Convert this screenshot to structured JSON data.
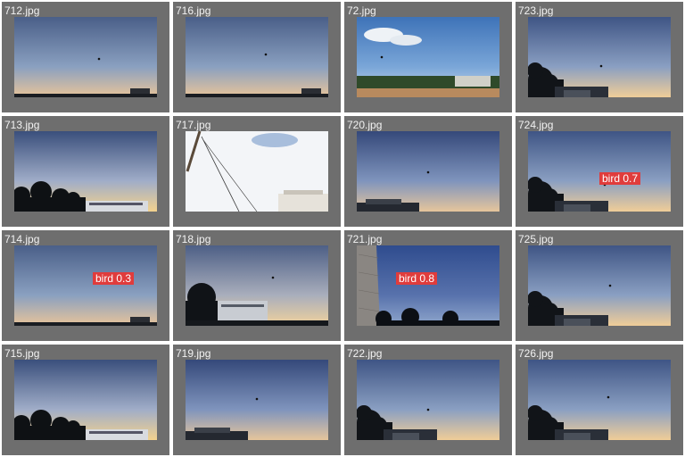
{
  "tiles": [
    {
      "file": "712.jpg",
      "scene": "dusk_low"
    },
    {
      "file": "716.jpg",
      "scene": "dusk_low"
    },
    {
      "file": "72.jpg",
      "scene": "cloudy_field"
    },
    {
      "file": "723.jpg",
      "scene": "dusk_tree_left"
    },
    {
      "file": "713.jpg",
      "scene": "dusk_building"
    },
    {
      "file": "717.jpg",
      "scene": "white_sky_pole"
    },
    {
      "file": "720.jpg",
      "scene": "dusk_building_small"
    },
    {
      "file": "724.jpg",
      "scene": "dusk_tree_left",
      "detection": {
        "label": "bird 0.7"
      }
    },
    {
      "file": "714.jpg",
      "scene": "dusk_low",
      "detection": {
        "label": "bird 0.3"
      }
    },
    {
      "file": "718.jpg",
      "scene": "dusk_tree_building"
    },
    {
      "file": "721.jpg",
      "scene": "blue_wall_trees",
      "detection": {
        "label": "bird 0.8"
      }
    },
    {
      "file": "725.jpg",
      "scene": "dusk_tree_left"
    },
    {
      "file": "715.jpg",
      "scene": "dusk_building"
    },
    {
      "file": "719.jpg",
      "scene": "dusk_building_small"
    },
    {
      "file": "722.jpg",
      "scene": "dusk_tree_left"
    },
    {
      "file": "726.jpg",
      "scene": "dusk_tree_left"
    }
  ],
  "colors": {
    "tile_bg": "#6e6e6e",
    "grid_bg": "#ffffff",
    "label_text": "#f2f2f2",
    "detection_bg": "#e03c3c",
    "detection_text": "#ffffff"
  }
}
